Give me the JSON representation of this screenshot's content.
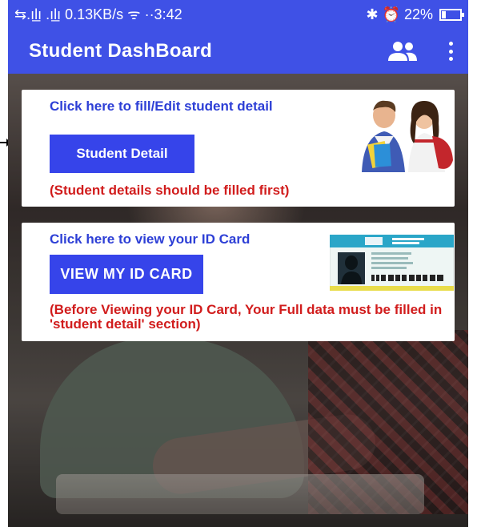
{
  "status_bar": {
    "left_text": "⇆.ıl̲ı .ıl̲ı 0.13KB/s ᯤ ··3:42",
    "right_text": "✱ ⏰ 22%"
  },
  "app_bar": {
    "title": "Student DashBoard"
  },
  "card_detail": {
    "heading": "Click here to fill/Edit student detail",
    "button_label": "Student Detail",
    "note": "(Student details should be filled first)"
  },
  "card_id": {
    "heading": "Click here to view your ID Card",
    "button_label": "VIEW MY ID CARD",
    "note": "(Before Viewing your ID Card, Your Full data must be filled in 'student detail' section)"
  },
  "colors": {
    "primary": "#3f51e6",
    "button": "#3644ea",
    "heading": "#2d3fd6",
    "warning": "#d11c1c"
  },
  "icons": [
    "people-icon",
    "more-vert-icon",
    "battery-icon",
    "students-illustration",
    "id-card-illustration"
  ]
}
